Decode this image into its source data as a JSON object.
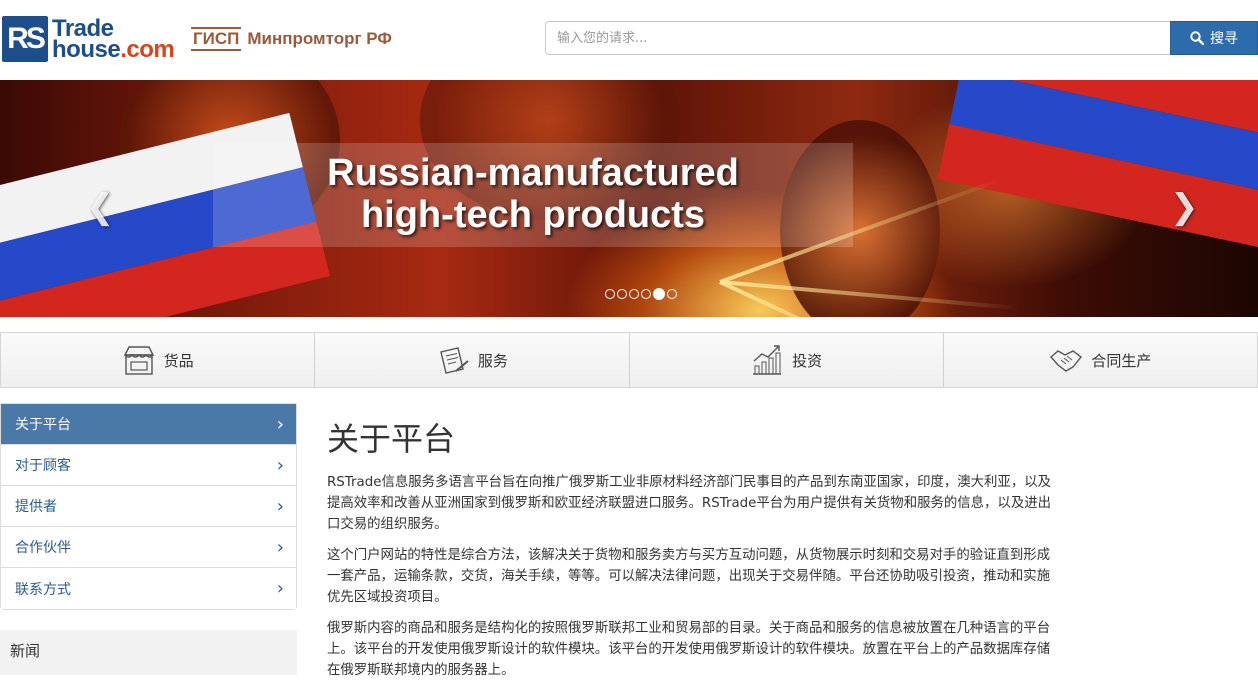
{
  "header": {
    "logo_rs_box": "RS",
    "logo_rs_line1": "Trade",
    "logo_rs_line2a": "house",
    "logo_rs_line2b": ".com",
    "logo_gisp_word": "ГИСП",
    "logo_gisp_min": "Минпромторг РФ",
    "search_placeholder": "输入您的请求...",
    "search_button": "搜寻"
  },
  "banner": {
    "caption_line1": "Russian-manufactured",
    "caption_line2": "high-tech products",
    "slide_count": 6,
    "active_slide": 5,
    "colors": {
      "flag_white": "#f2f2f2",
      "flag_blue": "#2649c9",
      "flag_red": "#d3261f"
    }
  },
  "categories": [
    {
      "label": "货品",
      "icon": "shop-icon"
    },
    {
      "label": "服务",
      "icon": "document-pen-icon"
    },
    {
      "label": "投资",
      "icon": "growth-chart-icon"
    },
    {
      "label": "合同生产",
      "icon": "handshake-icon"
    }
  ],
  "sidebar": {
    "items": [
      {
        "label": "关于平台",
        "active": true
      },
      {
        "label": "对于顾客",
        "active": false
      },
      {
        "label": "提供者",
        "active": false
      },
      {
        "label": "合作伙伴",
        "active": false
      },
      {
        "label": "联系方式",
        "active": false
      }
    ],
    "news_label": "新闻"
  },
  "main": {
    "title": "关于平台",
    "paragraphs": [
      "RSTrade信息服务多语言平台旨在向推广俄罗斯工业非原材料经济部门民事目的产品到东南亚国家，印度，澳大利亚，以及提高效率和改善从亚洲国家到俄罗斯和欧亚经济联盟进口服务。RSTrade平台为用户提供有关货物和服务的信息，以及进出口交易的组织服务。",
      "这个门户网站的特性是综合方法，该解决关于货物和服务卖方与买方互动问题，从货物展示时刻和交易对手的验证直到形成一套产品，运输条款，交货，海关手续，等等。可以解决法律问题，出现关于交易伴随。平台还协助吸引投资，推动和实施优先区域投资项目。",
      "俄罗斯内容的商品和服务是结构化的按照俄罗斯联邦工业和贸易部的目录。关于商品和服务的信息被放置在几种语言的平台上。该平台的开发使用俄罗斯设计的软件模块。该平台的开发使用俄罗斯设计的软件模块。放置在平台上的产品数据库存储在俄罗斯联邦境内的服务器上。"
    ]
  },
  "colors": {
    "brand_blue": "#1e4d8c",
    "brand_orange": "#d6461b",
    "active_blue": "#4a79a8",
    "link_blue": "#2a5b8d",
    "button_blue": "#2c6cad"
  }
}
